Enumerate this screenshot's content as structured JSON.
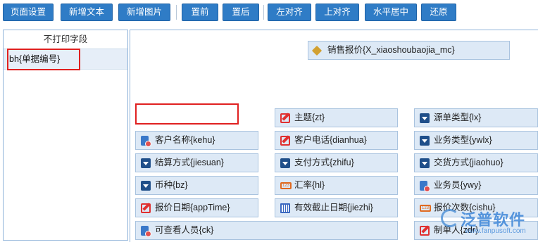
{
  "toolbar": {
    "buttons": [
      {
        "name": "page-settings-button",
        "label": "页面设置"
      },
      {
        "name": "add-text-button",
        "label": "新增文本"
      },
      {
        "name": "add-image-button",
        "label": "新增图片"
      },
      {
        "name": "bring-front-button",
        "label": "置前"
      },
      {
        "name": "send-back-button",
        "label": "置后"
      },
      {
        "name": "align-left-button",
        "label": "左对齐"
      },
      {
        "name": "align-top-button",
        "label": "上对齐"
      },
      {
        "name": "center-horizontal-button",
        "label": "水平居中"
      },
      {
        "name": "restore-button",
        "label": "还原"
      }
    ],
    "colors": {
      "button_bg": "#2f7cc6",
      "button_text": "#ffffff"
    }
  },
  "left_panel": {
    "header": "不打印字段",
    "items": [
      "bh{单据编号}"
    ]
  },
  "canvas": {
    "title_field": {
      "label": "销售报价{X_xiaoshoubaojia_mc}",
      "icon": "pencil-icon"
    },
    "fields": [
      {
        "label": "主题{zt}",
        "icon": "edit-icon"
      },
      {
        "label": "源单类型{lx}",
        "icon": "dropdown-icon"
      },
      {
        "label": "客户名称{kehu}",
        "icon": "document-icon"
      },
      {
        "label": "客户电话{dianhua}",
        "icon": "edit-icon"
      },
      {
        "label": "业务类型{ywlx}",
        "icon": "dropdown-icon"
      },
      {
        "label": "结算方式{jiesuan}",
        "icon": "dropdown-icon"
      },
      {
        "label": "支付方式{zhifu}",
        "icon": "dropdown-icon"
      },
      {
        "label": "交货方式{jiaohuo}",
        "icon": "dropdown-icon"
      },
      {
        "label": "币种{bz}",
        "icon": "dropdown-icon"
      },
      {
        "label": "汇率{hl}",
        "icon": "number-icon"
      },
      {
        "label": "业务员{ywy}",
        "icon": "document-icon"
      },
      {
        "label": "报价日期{appTime}",
        "icon": "edit-icon"
      },
      {
        "label": "有效截止日期{jiezhi}",
        "icon": "calendar-icon"
      },
      {
        "label": "报价次数{cishu}",
        "icon": "number-icon"
      },
      {
        "label": "可查看人员{ck}",
        "icon": "document-icon"
      },
      {
        "label": "制单人{zdr}",
        "icon": "edit-icon"
      }
    ]
  },
  "watermark": {
    "brand": "泛普软件",
    "url": "www.fanpusoft.com"
  }
}
